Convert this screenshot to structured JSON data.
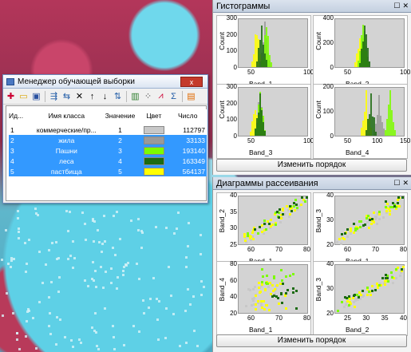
{
  "dialog": {
    "title": "Менеджер обучающей выборки",
    "close_label": "x",
    "columns": [
      "Ид...",
      "Имя класса",
      "Значение",
      "Цвет",
      "Число"
    ],
    "rows": [
      {
        "id": "1",
        "name": "коммерческие/пр...",
        "value": "1",
        "color": "#c8c8c8",
        "count": "112797",
        "selected": false
      },
      {
        "id": "2",
        "name": "жила",
        "value": "2",
        "color": "#9a9a9a",
        "count": "33133",
        "selected": true
      },
      {
        "id": "3",
        "name": "Пашни",
        "value": "3",
        "color": "#7cfc00",
        "count": "193140",
        "selected": true
      },
      {
        "id": "4",
        "name": "леса",
        "value": "4",
        "color": "#1d6b12",
        "count": "163349",
        "selected": true
      },
      {
        "id": "5",
        "name": "пастбища",
        "value": "5",
        "color": "#ffff00",
        "count": "564137",
        "selected": true
      }
    ],
    "toolbar_icons": [
      "merge-icon",
      "open-folder-icon",
      "save-icon",
      "split-icon",
      "split-all-icon",
      "delete-icon",
      "move-up-icon",
      "move-down-icon",
      "sort-icon",
      "histogram-icon",
      "scatter-icon",
      "statistics-icon",
      "sigma-icon",
      "layers-icon"
    ]
  },
  "histograms": {
    "title": "Гистограммы",
    "button": "Изменить порядок",
    "plots": [
      {
        "xlabel": "Band_1",
        "ylabel": "Count"
      },
      {
        "xlabel": "Band_2",
        "ylabel": "Count"
      },
      {
        "xlabel": "Band_3",
        "ylabel": "Count"
      },
      {
        "xlabel": "Band_4",
        "ylabel": "Count"
      }
    ]
  },
  "scatter": {
    "title": "Диаграммы рассеивания",
    "button": "Изменить порядок",
    "plots": [
      {
        "xlabel": "Band_1",
        "ylabel": "Band_2"
      },
      {
        "xlabel": "Band_1",
        "ylabel": "Band_3"
      },
      {
        "xlabel": "Band_1",
        "ylabel": "Band_4"
      },
      {
        "xlabel": "Band_2",
        "ylabel": "Band_3"
      }
    ]
  },
  "chart_data": [
    {
      "type": "bar",
      "title": "",
      "xlabel": "Band_1",
      "ylabel": "Count",
      "ylim": [
        0,
        300
      ],
      "xticks": [
        "50",
        "100"
      ],
      "yticks": [
        "0",
        "100",
        "200",
        "300"
      ]
    },
    {
      "type": "bar",
      "title": "",
      "xlabel": "Band_2",
      "ylabel": "Count",
      "ylim": [
        0,
        400
      ],
      "xticks": [
        "50",
        "100"
      ],
      "yticks": [
        "0",
        "200",
        "400"
      ]
    },
    {
      "type": "bar",
      "title": "",
      "xlabel": "Band_3",
      "ylabel": "Count",
      "ylim": [
        0,
        300
      ],
      "xticks": [
        "50",
        "100"
      ],
      "yticks": [
        "0",
        "100",
        "200",
        "300"
      ]
    },
    {
      "type": "bar",
      "title": "",
      "xlabel": "Band_4",
      "ylabel": "Count",
      "ylim": [
        0,
        200
      ],
      "xticks": [
        "50",
        "100",
        "150"
      ],
      "yticks": [
        "0",
        "100",
        "200"
      ]
    },
    {
      "type": "scatter",
      "title": "",
      "xlabel": "Band_1",
      "ylabel": "Band_2",
      "xticks": [
        "60",
        "70",
        "80"
      ],
      "yticks": [
        "25",
        "30",
        "35",
        "40"
      ]
    },
    {
      "type": "scatter",
      "title": "",
      "xlabel": "Band_1",
      "ylabel": "Band_3",
      "xticks": [
        "60",
        "70",
        "80"
      ],
      "yticks": [
        "20",
        "30",
        "40"
      ]
    },
    {
      "type": "scatter",
      "title": "",
      "xlabel": "Band_1",
      "ylabel": "Band_4",
      "xticks": [
        "60",
        "70",
        "80"
      ],
      "yticks": [
        "20",
        "40",
        "60",
        "80"
      ]
    },
    {
      "type": "scatter",
      "title": "",
      "xlabel": "Band_2",
      "ylabel": "Band_3",
      "xticks": [
        "25",
        "30",
        "35",
        "40"
      ],
      "yticks": [
        "20",
        "30",
        "40"
      ]
    }
  ]
}
